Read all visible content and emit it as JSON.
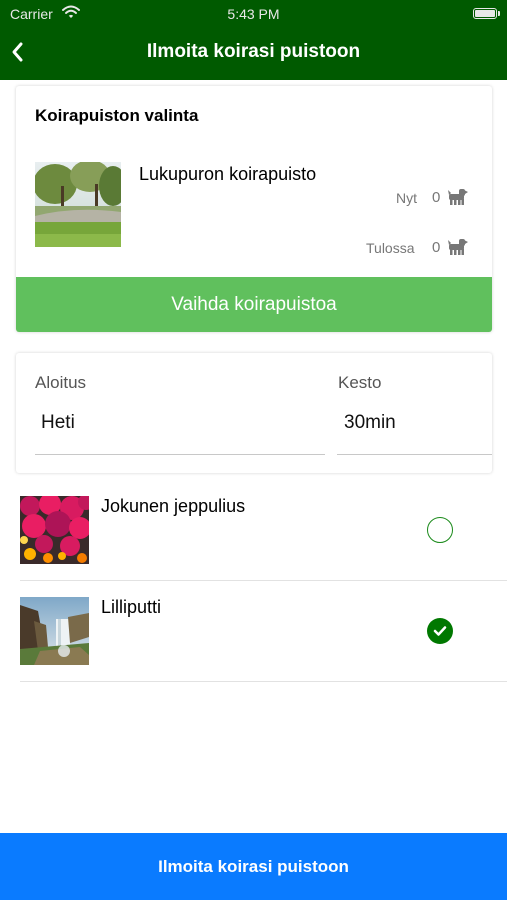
{
  "status_bar": {
    "carrier": "Carrier",
    "time": "5:43 PM"
  },
  "nav": {
    "title": "Ilmoita koirasi puistoon",
    "back_icon": "chevron-left-icon"
  },
  "park_card": {
    "title": "Koirapuiston valinta",
    "park_name": "Lukupuron koirapuisto",
    "now_label": "Nyt",
    "now_count": "0",
    "coming_label": "Tulossa",
    "coming_count": "0",
    "change_button": "Vaihda koirapuistoa"
  },
  "time_card": {
    "start_label": "Aloitus",
    "start_value": "Heti",
    "duration_label": "Kesto",
    "duration_value": "30min"
  },
  "dogs": [
    {
      "name": "Jokunen jeppulius",
      "selected": false
    },
    {
      "name": "Lilliputti",
      "selected": true
    }
  ],
  "submit_button": "Ilmoita koirasi puistoon",
  "colors": {
    "header": "#005a00",
    "change_button": "#60c05d",
    "submit_button": "#0a7bff",
    "selected_radio": "#007800"
  }
}
